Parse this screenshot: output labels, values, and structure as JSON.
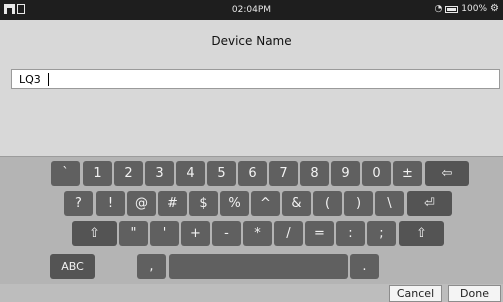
{
  "status_bar": {
    "time": "02:04PM",
    "battery_text": "100%",
    "icons": [
      "home-icon",
      "document-icon",
      "wifi-icon",
      "battery-icon",
      "settings-icon"
    ]
  },
  "dialog": {
    "title": "Device Name",
    "input_value": "LQ3"
  },
  "keyboard": {
    "row1": [
      "`",
      "1",
      "2",
      "3",
      "4",
      "5",
      "6",
      "7",
      "8",
      "9",
      "0",
      "±",
      "⇦"
    ],
    "row2": [
      "?",
      "!",
      "@",
      "#",
      "$",
      "%",
      "^",
      "&",
      "(",
      ")",
      "\\",
      "⏎"
    ],
    "row3": [
      "⇧",
      "\"",
      "'",
      "+",
      "-",
      "*",
      "/",
      "=",
      ":",
      ";",
      "⇧"
    ],
    "row4": [
      "ABC",
      ",",
      "",
      "."
    ]
  },
  "actions": {
    "cancel_label": "Cancel",
    "done_label": "Done"
  },
  "colors": {
    "status_bar_bg": "#1e1e1e",
    "dialog_bg": "#d8d8d8",
    "keyboard_bg": "#b4b4b4",
    "key_bg": "#606060"
  }
}
